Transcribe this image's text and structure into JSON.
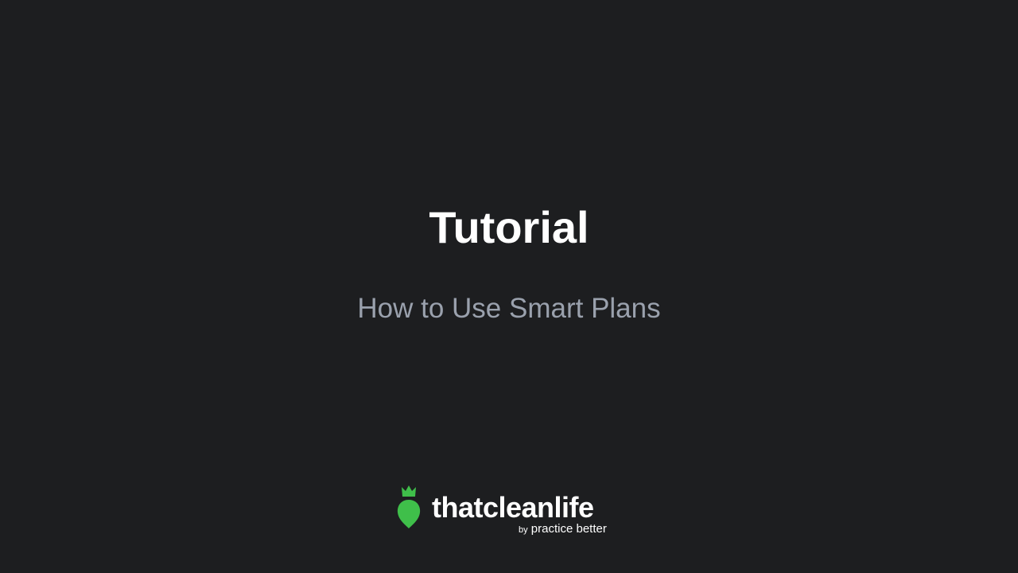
{
  "slide": {
    "title": "Tutorial",
    "subtitle": "How to Use Smart Plans",
    "background": "#1d1e20",
    "title_color": "#ffffff",
    "subtitle_color": "#9aa1ad"
  },
  "logo": {
    "wordmark": "thatcleanlife",
    "tagline_by": "by",
    "tagline_brand": "practice better",
    "icon": "green-vegetable-icon",
    "icon_color": "#3fbf4a"
  }
}
